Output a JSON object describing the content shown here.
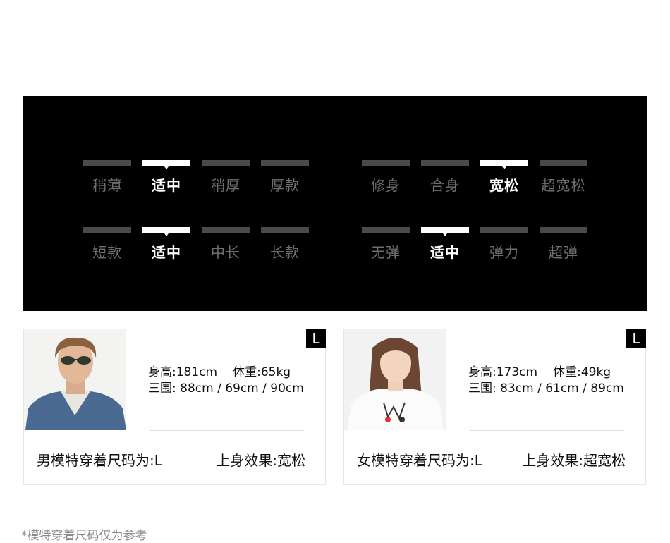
{
  "fit_panel": {
    "left_group": [
      {
        "options": [
          "稍薄",
          "适中",
          "稍厚",
          "厚款"
        ],
        "selected": 1
      },
      {
        "options": [
          "短款",
          "适中",
          "中长",
          "长款"
        ],
        "selected": 1
      }
    ],
    "right_group": [
      {
        "options": [
          "修身",
          "合身",
          "宽松",
          "超宽松"
        ],
        "selected": 2
      },
      {
        "options": [
          "无弹",
          "适中",
          "弹力",
          "超弹"
        ],
        "selected": 1
      }
    ]
  },
  "models": [
    {
      "size_tag": "L",
      "height": "身高:181cm",
      "weight": "体重:65kg",
      "measurements": "三围: 88cm / 69cm / 90cm",
      "size_worn": "男模特穿着尺码为:L",
      "fit_effect": "上身效果:宽松"
    },
    {
      "size_tag": "L",
      "height": "身高:173cm",
      "weight": "体重:49kg",
      "measurements": "三围: 83cm / 61cm / 89cm",
      "size_worn": "女模特穿着尺码为:L",
      "fit_effect": "上身效果:超宽松"
    }
  ],
  "footnote": "*模特穿着尺码仅为参考",
  "colors": {
    "panel_bg": "#000000",
    "active": "#ffffff",
    "inactive": "#4a4a4a",
    "inactive_text": "#6e6e6e"
  }
}
